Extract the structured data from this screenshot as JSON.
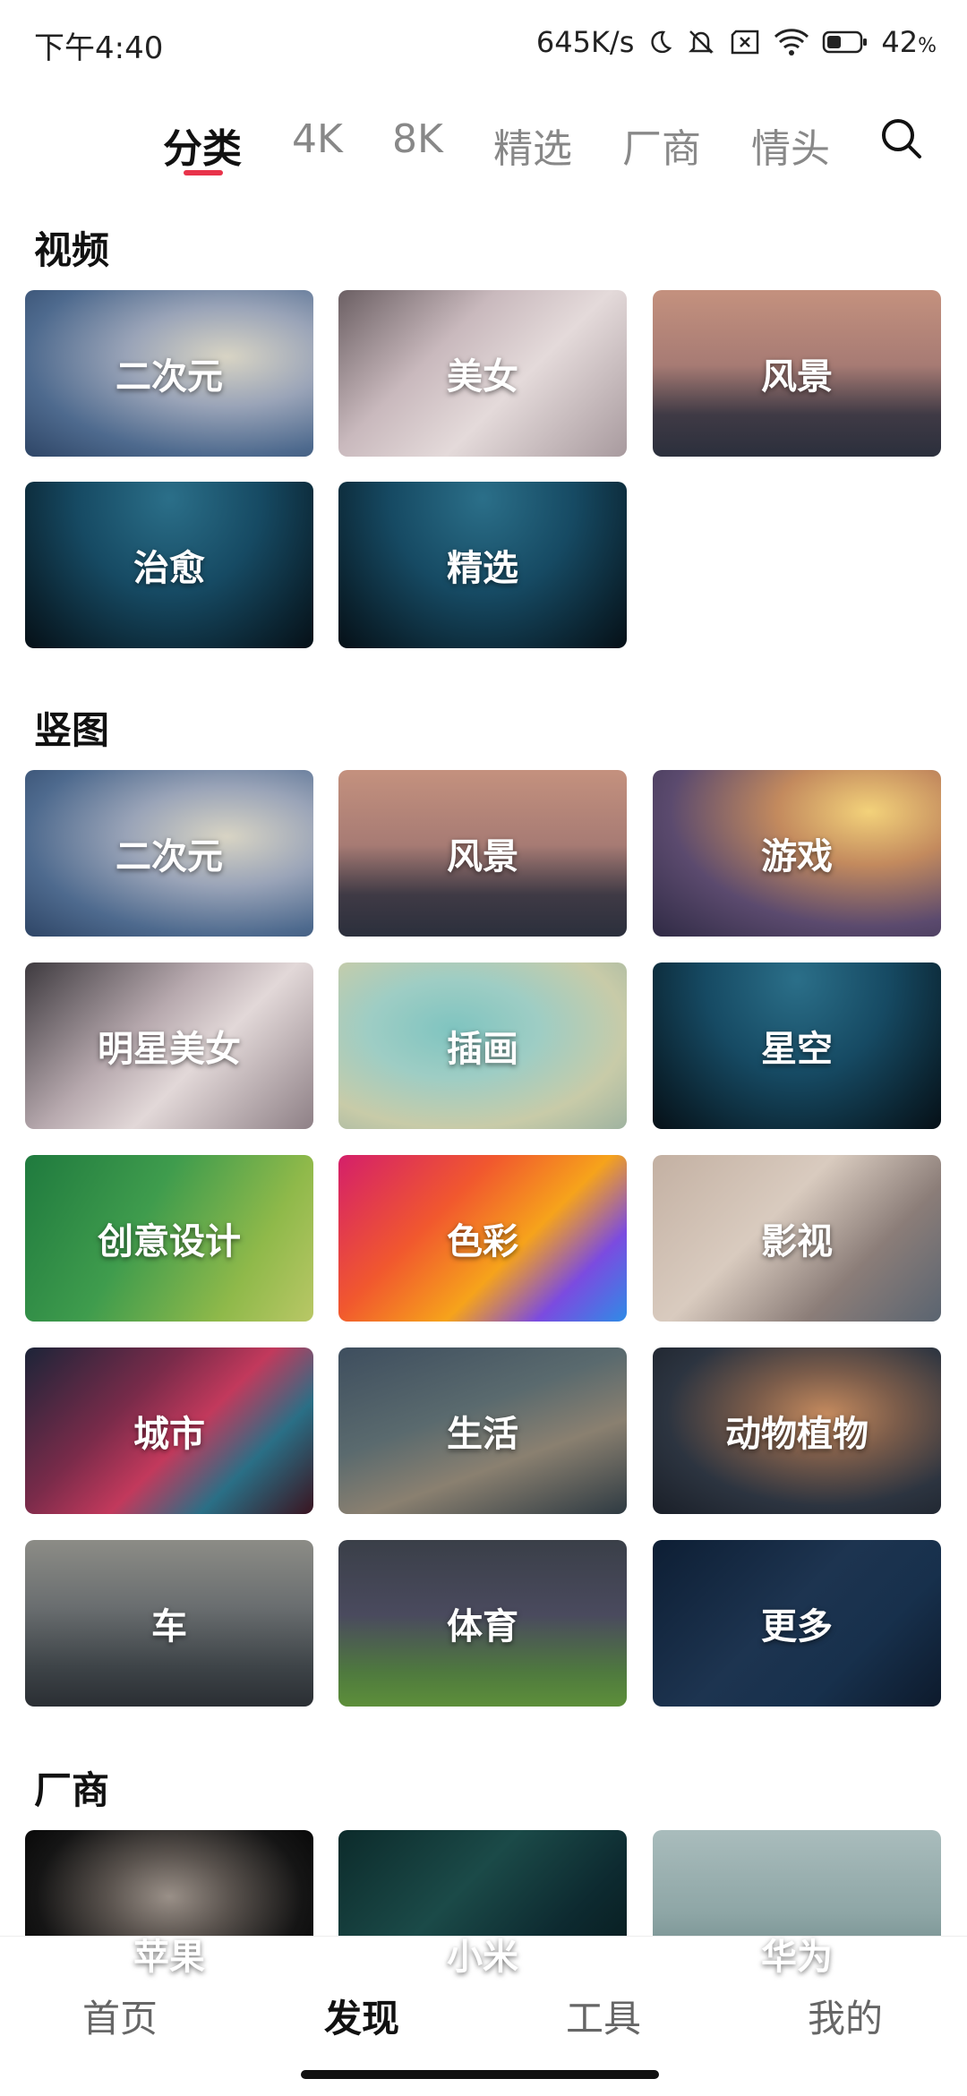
{
  "status_bar": {
    "time": "下午4:40",
    "net_speed": "645K/s",
    "battery": "42",
    "battery_unit": "%",
    "icons": [
      "moon-icon",
      "bell-muted-icon",
      "sim-x-icon",
      "wifi-icon",
      "battery-icon"
    ]
  },
  "top_tabs": [
    {
      "label": "分类",
      "active": true
    },
    {
      "label": "4K"
    },
    {
      "label": "8K"
    },
    {
      "label": "精选"
    },
    {
      "label": "厂商"
    },
    {
      "label": "情头"
    }
  ],
  "search_icon": "search-icon",
  "sections": {
    "video": {
      "title": "视频",
      "items": [
        "二次元",
        "美女",
        "风景",
        "治愈",
        "精选"
      ]
    },
    "portrait": {
      "title": "竖图",
      "items": [
        "二次元",
        "风景",
        "游戏",
        "明星美女",
        "插画",
        "星空",
        "创意设计",
        "色彩",
        "影视",
        "城市",
        "生活",
        "动物植物",
        "车",
        "体育",
        "更多"
      ]
    },
    "vendor": {
      "title": "厂商",
      "items": [
        "苹果",
        "小米",
        "华为"
      ]
    }
  },
  "bottom_nav": [
    {
      "label": "首页"
    },
    {
      "label": "发现",
      "active": true
    },
    {
      "label": "工具"
    },
    {
      "label": "我的"
    }
  ],
  "colors": {
    "accent": "#e8334a"
  }
}
